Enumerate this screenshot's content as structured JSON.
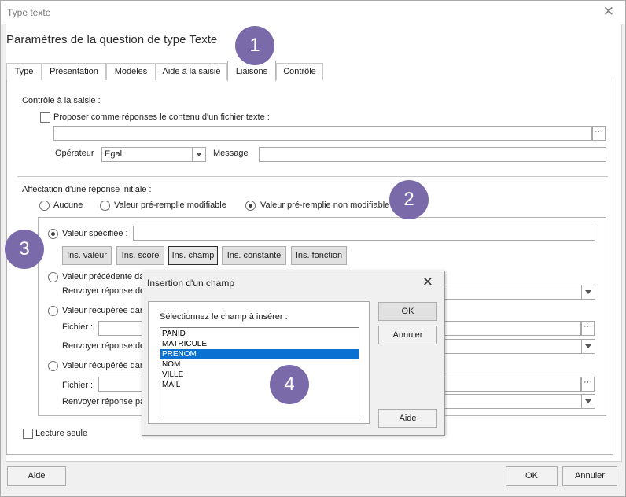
{
  "window": {
    "title": "Type texte",
    "close_glyph": "✕"
  },
  "dialog_title": "Paramètres de la question de type Texte",
  "tabs": [
    {
      "label": "Type",
      "active": false
    },
    {
      "label": "Présentation",
      "active": false
    },
    {
      "label": "Modèles",
      "active": false
    },
    {
      "label": "Aide à la saisie",
      "active": false
    },
    {
      "label": "Liaisons",
      "active": true
    },
    {
      "label": "Contrôle",
      "active": false
    }
  ],
  "controle": {
    "section_label": "Contrôle à la saisie :",
    "proposer_label": "Proposer comme réponses le contenu d'un fichier texte :",
    "file_value": "",
    "browse_label": "···",
    "operateur_label": "Opérateur",
    "operateur_value": "Egal",
    "message_label": "Message",
    "message_value": ""
  },
  "affectation": {
    "section_label": "Affectation d'une réponse initiale :",
    "options": [
      "Aucune",
      "Valeur pré-remplie modifiable",
      "Valeur pré-remplie non modifiable"
    ],
    "selected": "Valeur pré-remplie non modifiable"
  },
  "inner": {
    "valeur_specifiee": "Valeur spécifiée :",
    "valeur_specifiee_value": "",
    "buttons": [
      "Ins. valeur",
      "Ins. score",
      "Ins. champ",
      "Ins. constante",
      "Ins. fonction"
    ],
    "valeur_precedente": "Valeur précédente da",
    "renvoyer_1": "Renvoyer réponse de",
    "valeur_recuperee_1": "Valeur récupérée dar",
    "fichier_1": "Fichier :",
    "renvoyer_2": "Renvoyer réponse de",
    "valeur_recuperee_2": "Valeur récupérée dar",
    "fichier_2": "Fichier :",
    "renvoyer_3": "Renvoyer réponse pa"
  },
  "lecture_seule": "Lecture seule",
  "footer": {
    "aide": "Aide",
    "ok": "OK",
    "annuler": "Annuler"
  },
  "popup": {
    "title": "Insertion d'un champ",
    "close_glyph": "✕",
    "prompt": "Sélectionnez le champ à insérer :",
    "fields": [
      "PANID",
      "MATRICULE",
      "PRENOM",
      "NOM",
      "VILLE",
      "MAIL"
    ],
    "selected_field": "PRENOM",
    "ok": "OK",
    "annuler": "Annuler",
    "aide": "Aide"
  },
  "badges": [
    "1",
    "2",
    "3",
    "4"
  ],
  "colors": {
    "badge": "#7b6aaa",
    "selection": "#0a70d2"
  }
}
